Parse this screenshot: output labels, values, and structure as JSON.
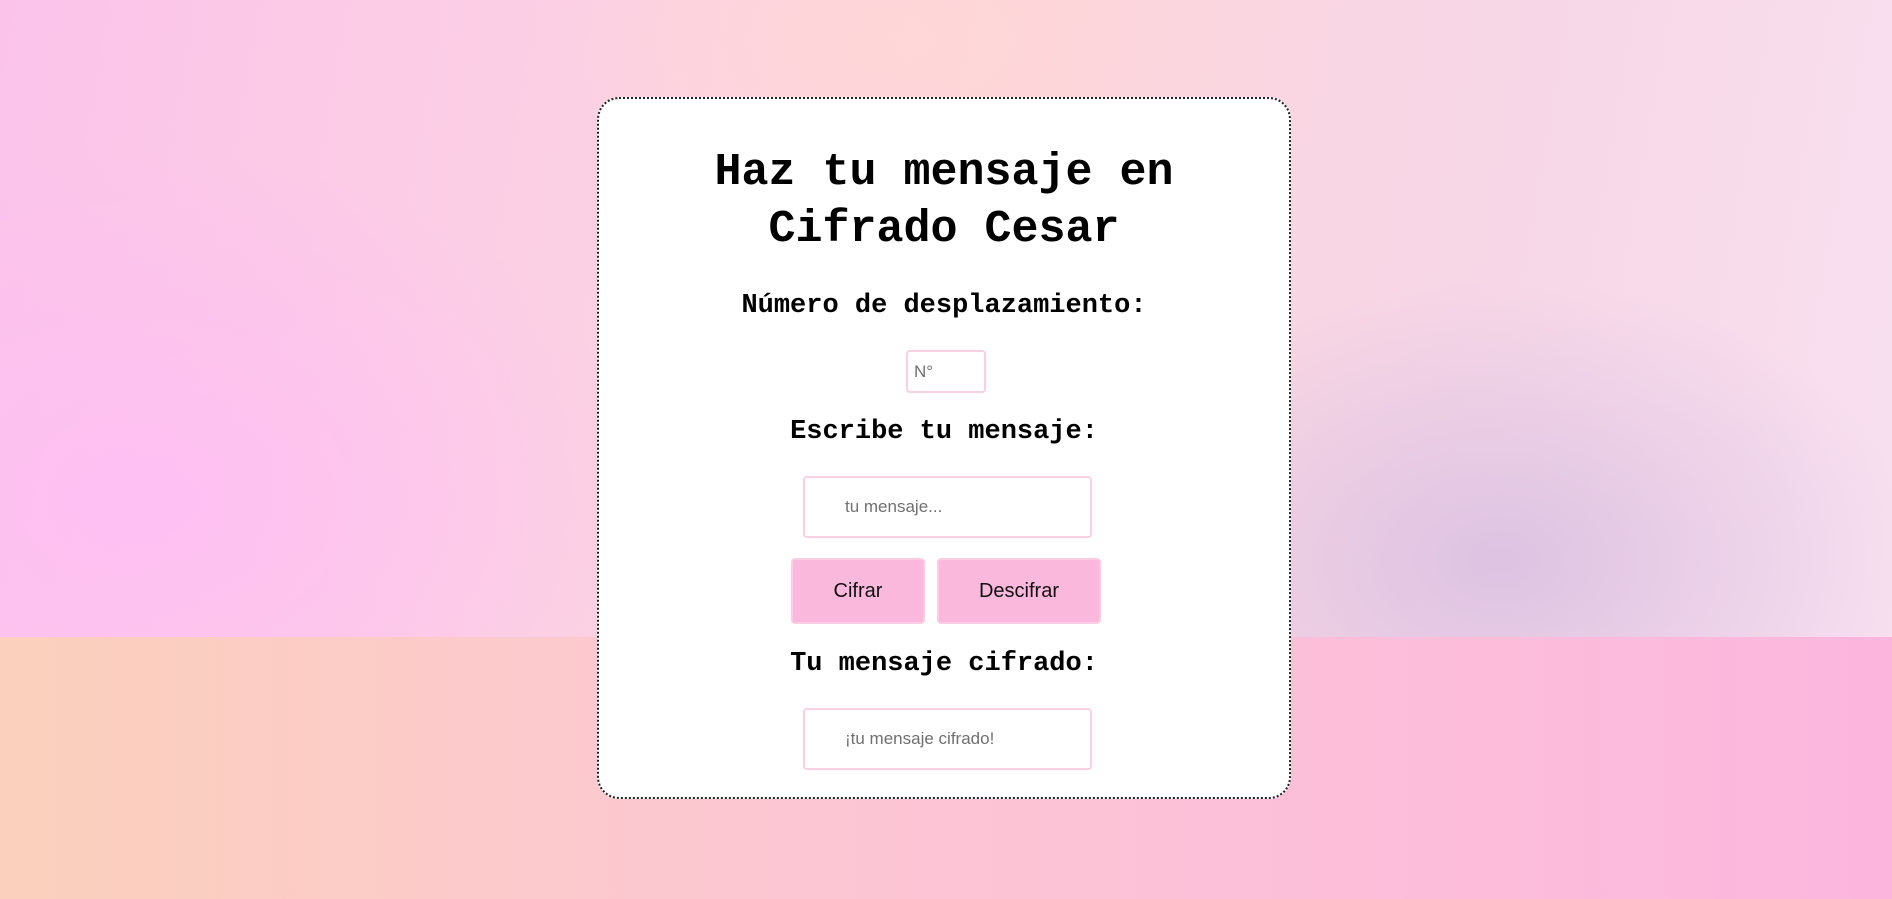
{
  "page": {
    "title_line1": "Haz tu mensaje en",
    "title_line2": "Cifrado Cesar"
  },
  "shift": {
    "label": "Número de desplazamiento:",
    "placeholder": "N°",
    "value": ""
  },
  "message": {
    "label": "Escribe tu mensaje:",
    "placeholder": "tu mensaje...",
    "value": ""
  },
  "actions": {
    "encrypt_label": "Cifrar",
    "decrypt_label": "Descifrar"
  },
  "output": {
    "label": "Tu mensaje cifrado:",
    "placeholder": "¡tu mensaje cifrado!",
    "value": ""
  },
  "colors": {
    "button_bg": "#fbb8dd",
    "field_border": "#f9cfe2"
  }
}
